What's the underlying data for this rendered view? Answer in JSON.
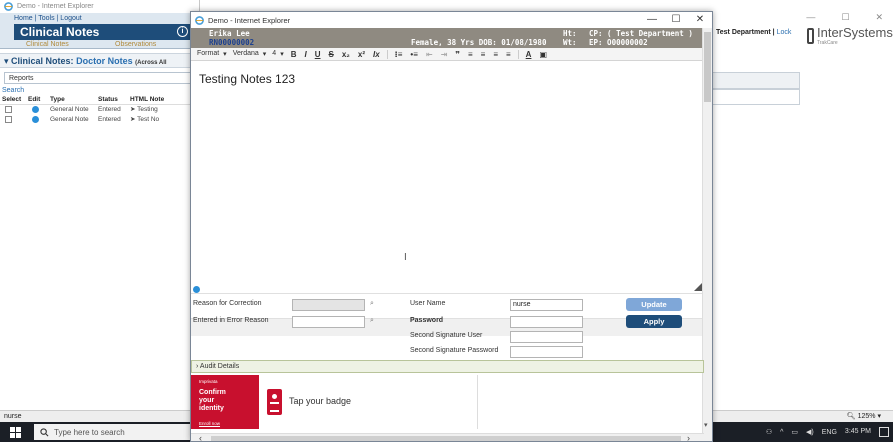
{
  "background_window": {
    "title": "Demo - Internet Explorer",
    "top_links": "Home | Tools | Logout",
    "page_title": "Clinical Notes",
    "tabs": [
      "Clinical Notes",
      "Observations"
    ],
    "section_title_prefix": "Clinical Notes:",
    "section_title_doc": "Doctor Notes",
    "section_title_suffix": "(Across All",
    "reports_label": "Reports",
    "search_label": "Search",
    "table": {
      "headers": [
        "Select",
        "Edit",
        "Type",
        "Status",
        "HTML Note"
      ],
      "rows": [
        {
          "type": "General Note",
          "status": "Entered",
          "note": "Testing"
        },
        {
          "type": "General Note",
          "status": "Entered",
          "note": "Test No"
        }
      ]
    }
  },
  "right_area": {
    "dept_label": "Test Department",
    "lock_label": "Lock",
    "logo_name": "InterSystems",
    "logo_sub": "TrakCare",
    "window_controls": [
      "—",
      "☐",
      "✕"
    ]
  },
  "dialog": {
    "title": "Demo - Internet Explorer",
    "window_controls": [
      "—",
      "☐",
      "✕"
    ],
    "patient": {
      "name": "Erika Lee",
      "mrn": "RN00000002",
      "demographics": "Female, 38 Yrs DOB: 01/08/1980",
      "ht": "Ht:",
      "wt": "Wt:",
      "cp": "CP: ( Test Department )",
      "ep": "EP: O00000002"
    },
    "toolbar": {
      "format": "Format",
      "font": "Verdana",
      "size": "4",
      "buttons": [
        "B",
        "I",
        "U",
        "S",
        "x₂",
        "x²",
        "Ix",
        "⁝≡",
        "•≡",
        "⇤",
        "⇥",
        "❞",
        "≡",
        "≡",
        "≡",
        "≡",
        "A",
        "▣"
      ]
    },
    "editor_text": "Testing Notes 123",
    "form": {
      "reason_label": "Reason for Correction",
      "error_label": "Entered in Error Reason",
      "user_label": "User Name",
      "user_value": "nurse",
      "password_label": "Password",
      "second_user_label": "Second Signature User",
      "second_password_label": "Second Signature Password",
      "update_label": "Update",
      "apply_label": "Apply"
    },
    "audit_label": "Audit Details",
    "badge": {
      "brand": "Imprivata",
      "confirm": "Confirm\nyour\nidentity",
      "enroll": "Enroll now",
      "tap": "Tap your badge"
    }
  },
  "status_bar": {
    "user": "nurse",
    "zoom": "125%"
  },
  "taskbar": {
    "search_placeholder": "Type here to search",
    "lang": "ENG",
    "time": "3:45 PM"
  }
}
